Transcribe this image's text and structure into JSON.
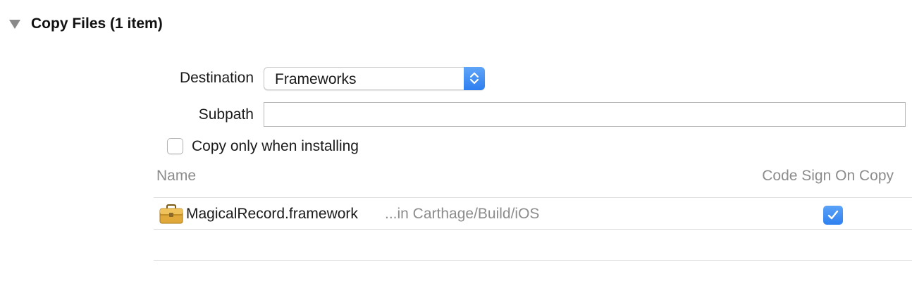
{
  "section": {
    "title": "Copy Files (1 item)",
    "expanded": true
  },
  "destination": {
    "label": "Destination",
    "value": "Frameworks"
  },
  "subpath": {
    "label": "Subpath",
    "value": ""
  },
  "copy_only_when_installing": {
    "label": "Copy only when installing",
    "checked": false
  },
  "table": {
    "columns": [
      "Name",
      "Code Sign On Copy"
    ],
    "rows": [
      {
        "icon": "framework-toolbox-icon",
        "name": "MagicalRecord.framework",
        "location": "...in Carthage/Build/iOS",
        "code_sign_on_copy": true
      }
    ]
  },
  "colors": {
    "accent": "#2f80f0",
    "secondary_text": "#8c8c8c",
    "divider": "#dedede"
  }
}
